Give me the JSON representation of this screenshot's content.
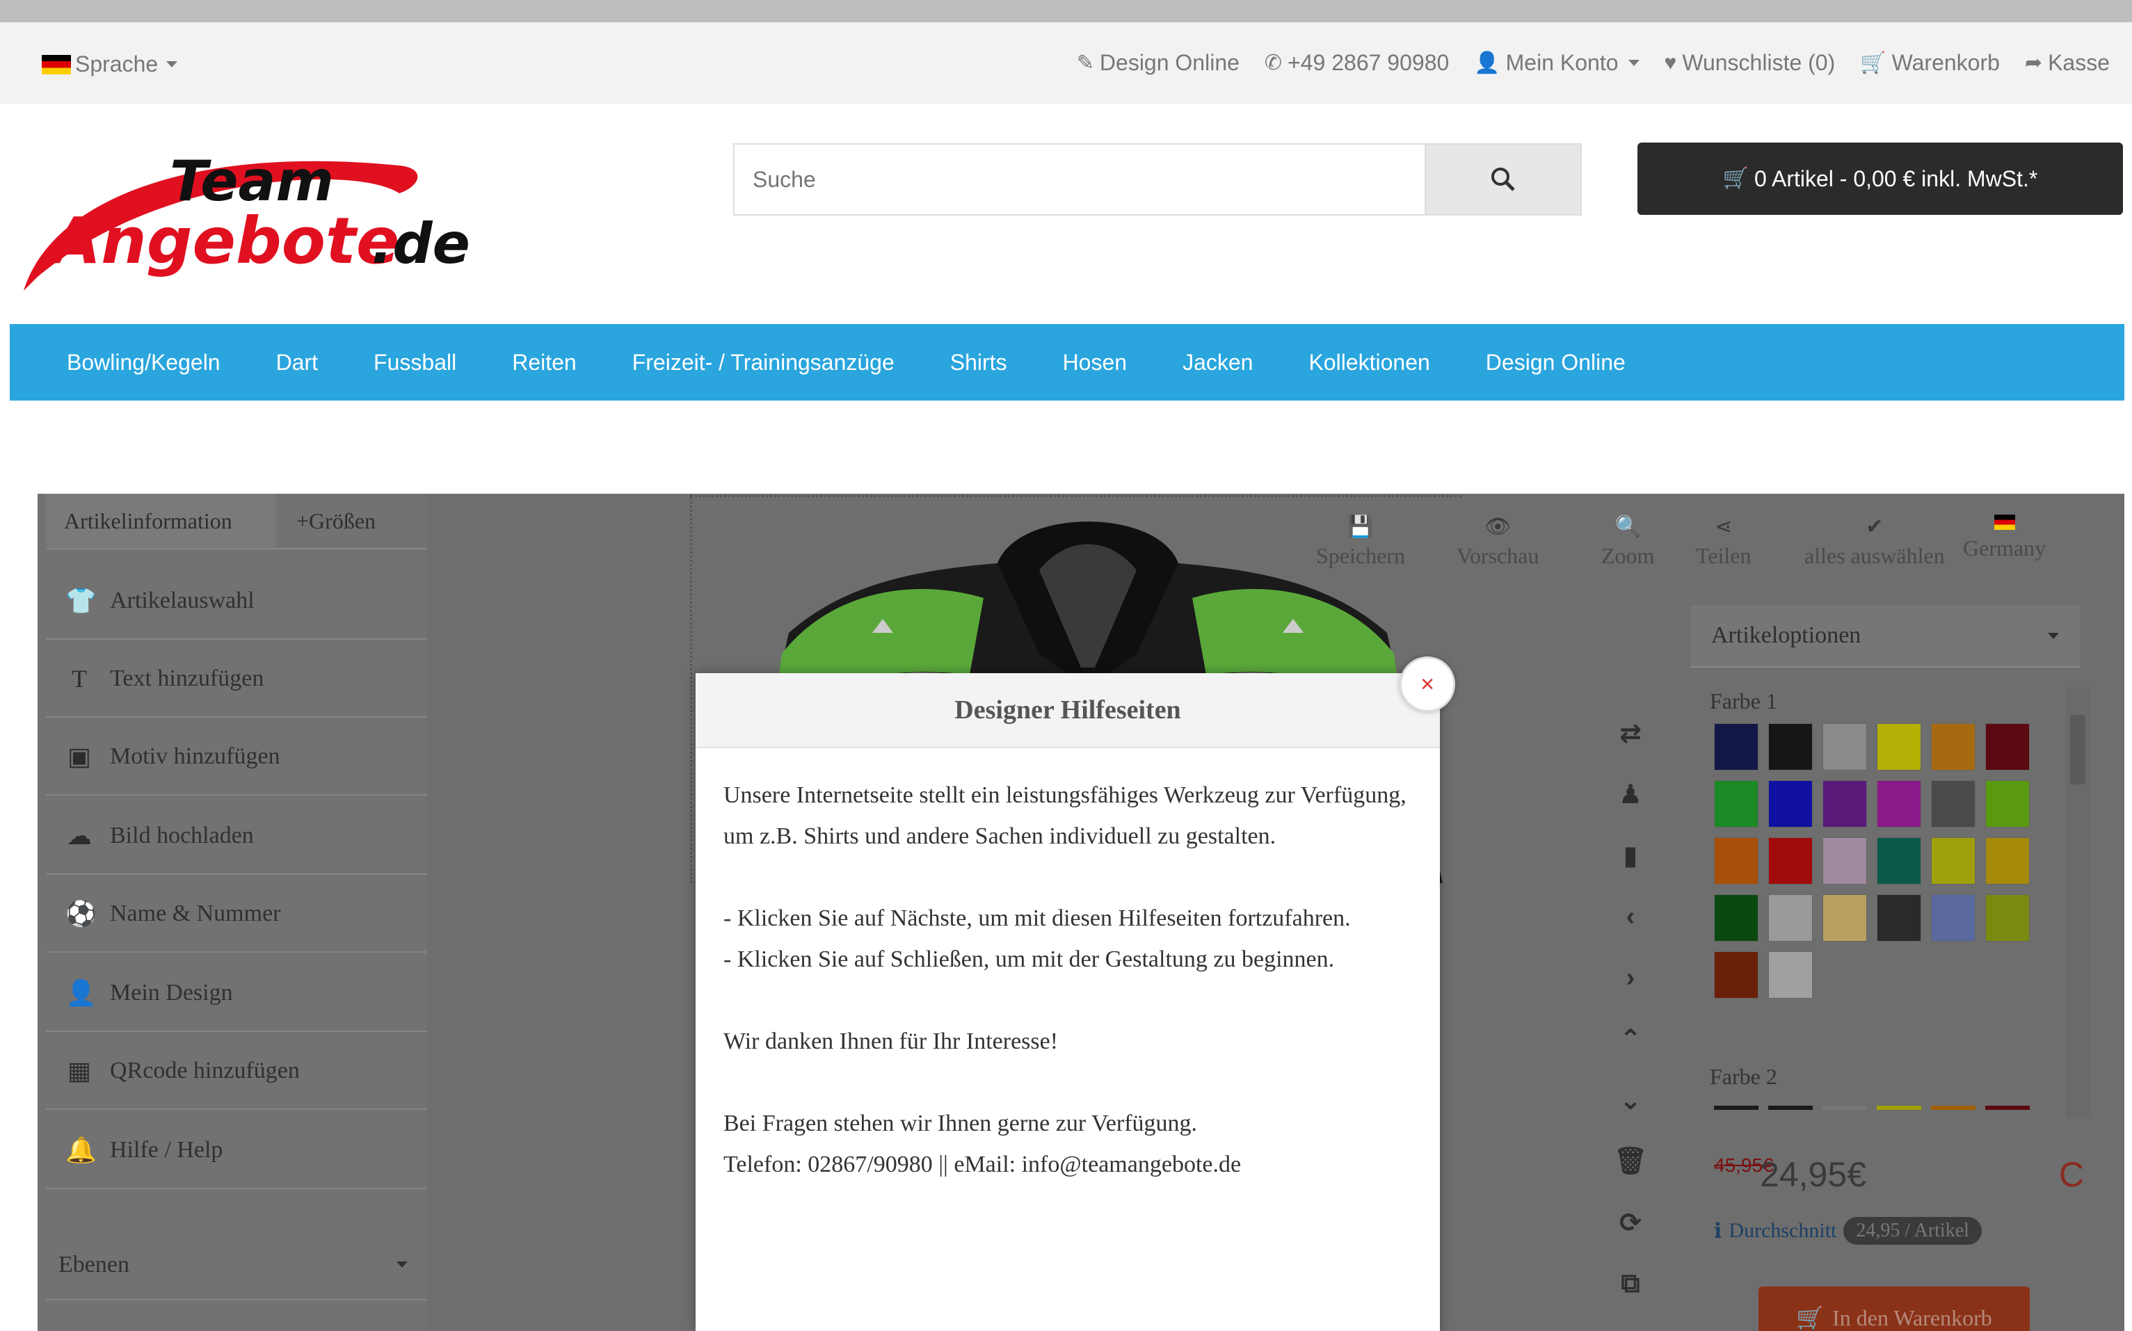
{
  "topbar": {
    "language_label": "Sprache",
    "links": [
      {
        "icon": "pencil-icon",
        "label": "Design Online"
      },
      {
        "icon": "phone-icon",
        "label": "+49 2867 90980"
      },
      {
        "icon": "user-icon",
        "label": "Mein Konto"
      },
      {
        "icon": "heart-icon",
        "label": "Wunschliste (0)"
      },
      {
        "icon": "cart-icon",
        "label": "Warenkorb"
      },
      {
        "icon": "share-icon",
        "label": "Kasse"
      }
    ]
  },
  "logo": {
    "line1": "Team",
    "line2": "Angebote",
    "suffix": ".de"
  },
  "search": {
    "placeholder": "Suche"
  },
  "cart": {
    "label": "0 Artikel - 0,00 € inkl. MwSt.*"
  },
  "nav": {
    "items": [
      "Bowling/Kegeln",
      "Dart",
      "Fussball",
      "Reiten",
      "Freizeit- / Trainingsanzüge",
      "Shirts",
      "Hosen",
      "Jacken",
      "Kollektionen",
      "Design Online"
    ]
  },
  "left_panel": {
    "tabs": [
      "Artikelinformation",
      "+Größen"
    ],
    "items": [
      {
        "icon": "shirt-icon",
        "label": "Artikelauswahl"
      },
      {
        "icon": "text-icon",
        "label": "Text hinzufügen"
      },
      {
        "icon": "image-icon",
        "label": "Motiv hinzufügen"
      },
      {
        "icon": "cloud-upload-icon",
        "label": "Bild hochladen"
      },
      {
        "icon": "soccer-ball-icon",
        "label": "Name & Nummer"
      },
      {
        "icon": "user-icon",
        "label": "Mein Design"
      },
      {
        "icon": "qrcode-icon",
        "label": "QRcode hinzufügen"
      },
      {
        "icon": "bell-icon",
        "label": "Hilfe / Help"
      }
    ],
    "layers_label": "Ebenen"
  },
  "toolbar": {
    "items": [
      {
        "icon": "save-icon",
        "label": "Speichern"
      },
      {
        "icon": "eye-icon",
        "label": "Vorschau"
      },
      {
        "icon": "zoom-icon",
        "label": "Zoom"
      },
      {
        "icon": "share-icon",
        "label": "Teilen"
      },
      {
        "icon": "check-icon",
        "label": "alles auswählen"
      },
      {
        "icon": "flag-icon",
        "label": "Germany"
      }
    ]
  },
  "article_options": {
    "title": "Artikeloptionen",
    "color1_label": "Farbe 1",
    "color2_label": "Farbe 2",
    "swatches": [
      "#141846",
      "#161616",
      "#8a8a8a",
      "#b5b006",
      "#a86a10",
      "#5a0a10",
      "#1a8a26",
      "#1010a0",
      "#5a1a7a",
      "#8a1a8a",
      "#4a4a4a",
      "#5a9a10",
      "#a8500a",
      "#a00a0a",
      "#a08aa0",
      "#0a5a4a",
      "#a0a00a",
      "#a88a0a",
      "#0a4a10",
      "#9a9a9a",
      "#b8a060",
      "#2a2a2a",
      "#5a6aa0",
      "#7a8a10",
      "#6a2008",
      "#a0a0a0"
    ],
    "color2_preview": [
      "#1a1a1a",
      "#1a1a1a",
      "#777",
      "#a0a000",
      "#a06000",
      "#5a0a10"
    ],
    "old_price": "45,95€",
    "price": "24,95€",
    "average_label": "Durchschnitt",
    "average_value": "24,95 / Artikel",
    "add_to_cart": "In den Warenkorb"
  },
  "modal": {
    "title": "Designer Hilfeseiten",
    "close": "×",
    "para1": "Unsere Internetseite stellt ein leistungsfähiges Werkzeug zur Verfügung, um z.B. Shirts und andere Sachen individuell zu gestalten.",
    "line1": "- Klicken Sie auf Nächste, um mit diesen Hilfeseiten fortzufahren.",
    "line2": "- Klicken Sie auf Schließen, um mit der Gestaltung zu beginnen.",
    "thanks": "Wir danken Ihnen für Ihr Interesse!",
    "questions": "Bei Fragen stehen wir Ihnen gerne zur Verfügung.",
    "contact": "Telefon: 02867/90980 || eMail: info@teamangebote.de"
  },
  "colors": {
    "nav": "#2aa5de",
    "cart_button": "#2b2b2b",
    "logo_red": "#e01020"
  }
}
